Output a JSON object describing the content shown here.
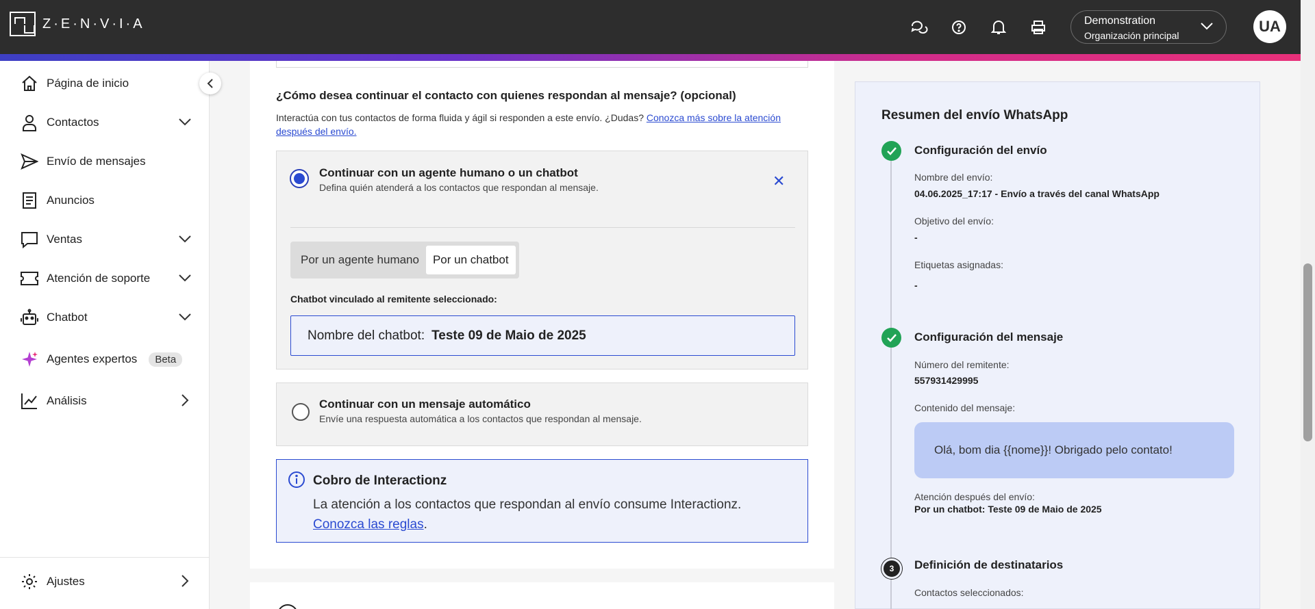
{
  "brand": {
    "logo_text": "Z·E·N·V·I·A"
  },
  "header": {
    "org_name": "Demonstration",
    "org_sub": "Organización principal",
    "avatar_initials": "UA",
    "icons": [
      "chat-help-icon",
      "help-icon",
      "bell-icon",
      "printer-icon"
    ]
  },
  "sidebar": {
    "items": [
      {
        "label": "Página de inicio",
        "icon": "home-icon"
      },
      {
        "label": "Contactos",
        "icon": "user-icon"
      },
      {
        "label": "Envío de mensajes",
        "icon": "send-icon"
      },
      {
        "label": "Anuncios",
        "icon": "document-icon"
      },
      {
        "label": "Ventas",
        "icon": "message-icon"
      },
      {
        "label": "Atención de soporte",
        "icon": "ticket-icon"
      },
      {
        "label": "Chatbot",
        "icon": "robot-icon"
      },
      {
        "label": "Agentes expertos",
        "icon": "sparkle-icon",
        "badge": "Beta"
      },
      {
        "label": "Análisis",
        "icon": "chart-icon"
      }
    ],
    "settings_label": "Ajustes"
  },
  "main": {
    "question": "¿Cómo desea continuar el contacto con quienes respondan al mensaje? (opcional)",
    "description": "Interactúa con tus contactos de forma fluida y ágil si responden a este envío. ¿Dudas?",
    "learn_more_link": "Conozca más sobre la atención después del envío.",
    "option1": {
      "title": "Continuar con un agente humano o un chatbot",
      "subtitle": "Defina quién atenderá a los contactos que respondan al mensaje.",
      "segments": [
        "Por un agente humano",
        "Por un chatbot"
      ],
      "linked_label": "Chatbot vinculado al remitente seleccionado:",
      "chatbot_field_label": "Nombre del chatbot:",
      "chatbot_field_value": "Teste 09 de Maio de 2025"
    },
    "option2": {
      "title": "Continuar con un mensaje automático",
      "subtitle": "Envíe una respuesta automática a los contactos que respondan al mensaje."
    },
    "info": {
      "title": "Cobro de Interactionz",
      "text": "La atención a los contactos que respondan al envío consume Interactionz.",
      "link": "Conozca las reglas",
      "link_suffix": "."
    }
  },
  "summary": {
    "title": "Resumen del envío WhatsApp",
    "step1": {
      "title": "Configuración del envío",
      "name_label": "Nombre del envío:",
      "name_value": "04.06.2025_17:17 - Envío a través del canal WhatsApp",
      "objective_label": "Objetivo del envío:",
      "objective_value": "-",
      "tags_label": "Etiquetas asignadas:",
      "tags_value": "-"
    },
    "step2": {
      "title": "Configuración del mensaje",
      "sender_label": "Número del remitente:",
      "sender_value": "557931429995",
      "content_label": "Contenido del mensaje:",
      "content_value": "Olá, bom dia {{nome}}! Obrigado pelo contato!",
      "after_label": "Atención después del envío:",
      "after_value": "Por un chatbot: Teste 09 de Maio de 2025"
    },
    "step3": {
      "number": "3",
      "title": "Definición de destinatarios",
      "contacts_label": "Contactos seleccionados:"
    }
  },
  "colors": {
    "accent": "#2a4ad1",
    "success": "#21a356",
    "topbar": "#2d2d2d",
    "summary_bg": "#eef1fb"
  }
}
